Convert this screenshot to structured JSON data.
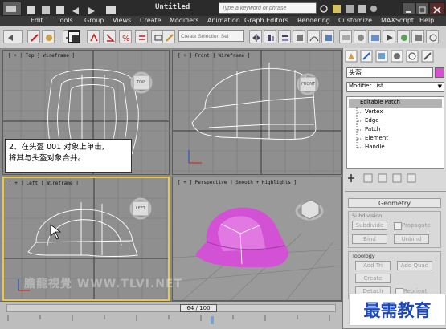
{
  "title_bar": {
    "title": "Untitled",
    "search_placeholder": "Type a keyword or phrase"
  },
  "menu": [
    "Edit",
    "Tools",
    "Group",
    "Views",
    "Create",
    "Modifiers",
    "Animation",
    "Graph Editors",
    "Rendering",
    "Customize",
    "MAXScript",
    "Help"
  ],
  "toolbar": {
    "selection_set_placeholder": "Create Selection Set"
  },
  "viewports": {
    "top": "[ + ] Top ] Wireframe ]",
    "front": "[ + ] Front ] Wireframe ]",
    "left": "[ + ] Left ] Wireframe ]",
    "perspective": "[ + ] Perspective ] Smooth + Highlights ]",
    "cube_top": "TOP",
    "cube_front": "FRONT",
    "cube_left": "LEFT"
  },
  "instruction": {
    "line1": "2、在头盔 001 对象上单击,",
    "line2": "将其与头盔对象合并。"
  },
  "right_panel": {
    "object_name": "头盔",
    "object_color": "#d94fd0",
    "modifier_list": "Modifier List",
    "stack": [
      "Editable Patch",
      "Vertex",
      "Edge",
      "Patch",
      "Element",
      "Handle"
    ],
    "geometry_header": "Geometry",
    "subdivision_label": "Subdivision",
    "subdivide": "Subdivide",
    "propagate": "Propagate",
    "bind": "Bind",
    "unbind": "Unbind",
    "topology_label": "Topology",
    "add_tri": "Add Tri",
    "add_quad": "Add Quad",
    "create": "Create",
    "detach": "Detach",
    "reorient": "Reorient"
  },
  "timeline": {
    "frame": "64 / 100"
  },
  "watermark_left": "膽龍視覺 WWW.TLVI.NET",
  "watermark_right": "最需教育"
}
